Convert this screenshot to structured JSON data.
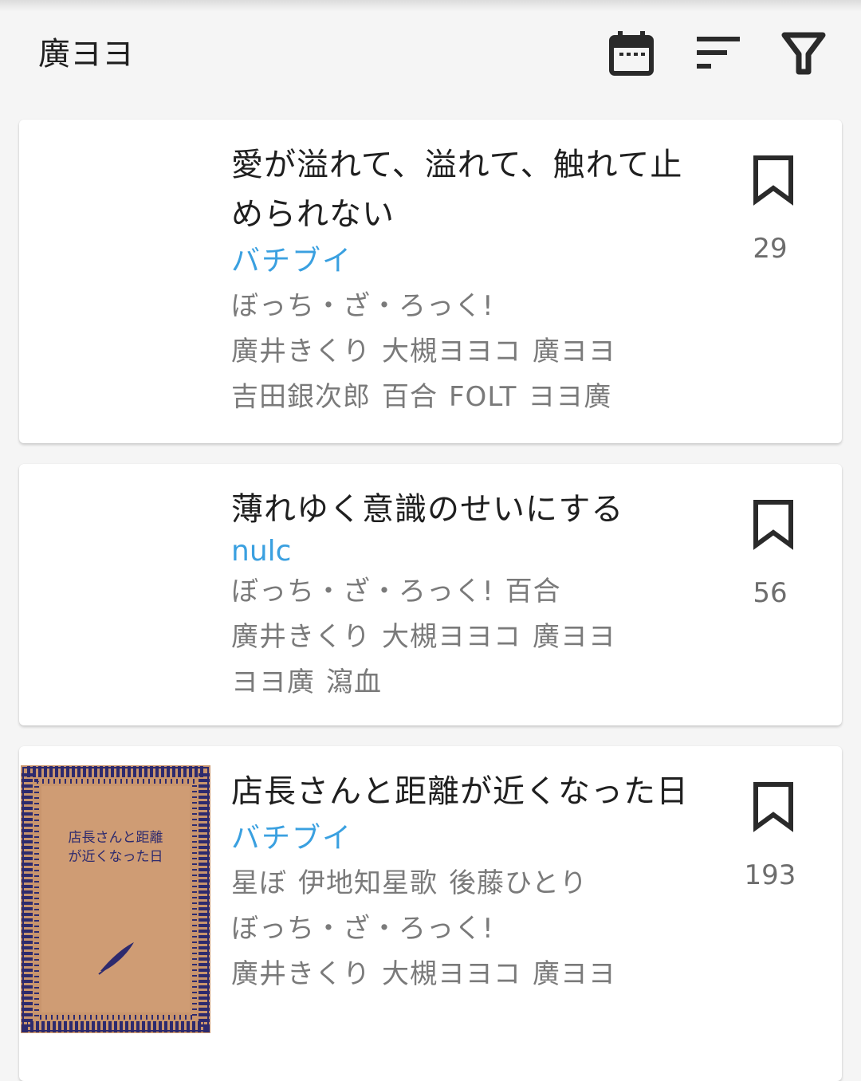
{
  "header": {
    "title": "廣ヨヨ",
    "icons": [
      "calendar-icon",
      "sort-icon",
      "filter-icon"
    ]
  },
  "works": [
    {
      "title": "愛が溢れて、溢れて、触れて止められない",
      "author": "バチブイ",
      "tags": [
        "ぼっち・ざ・ろっく!",
        "廣井きくり",
        "大槻ヨヨコ",
        "廣ヨヨ",
        "吉田銀次郎",
        "百合",
        "FOLT",
        "ヨヨ廣"
      ],
      "bookmark_count": "29",
      "has_cover": false
    },
    {
      "title": "薄れゆく意識のせいにする",
      "author": "nulc",
      "tags": [
        "ぼっち・ざ・ろっく!",
        "百合",
        "廣井きくり",
        "大槻ヨヨコ",
        "廣ヨヨ",
        "ヨヨ廣",
        "瀉血"
      ],
      "bookmark_count": "56",
      "has_cover": false
    },
    {
      "title": "店長さんと距離が近くなった日",
      "author": "バチブイ",
      "tags": [
        "星ぼ",
        "伊地知星歌",
        "後藤ひとり",
        "ぼっち・ざ・ろっく!",
        "廣井きくり",
        "大槻ヨヨコ",
        "廣ヨヨ"
      ],
      "bookmark_count": "193",
      "has_cover": true,
      "cover_text_line1": "店長さんと距離",
      "cover_text_line2": "が近くなった日"
    }
  ],
  "colors": {
    "background": "#f5f5f5",
    "card": "#ffffff",
    "author_link": "#3aa0e0",
    "tag_text": "#7a7a7a",
    "title_text": "#1f1f1f",
    "icon": "#2a2a2a",
    "cover_bg": "#c9956d",
    "cover_ornament": "#2d2a6e"
  }
}
